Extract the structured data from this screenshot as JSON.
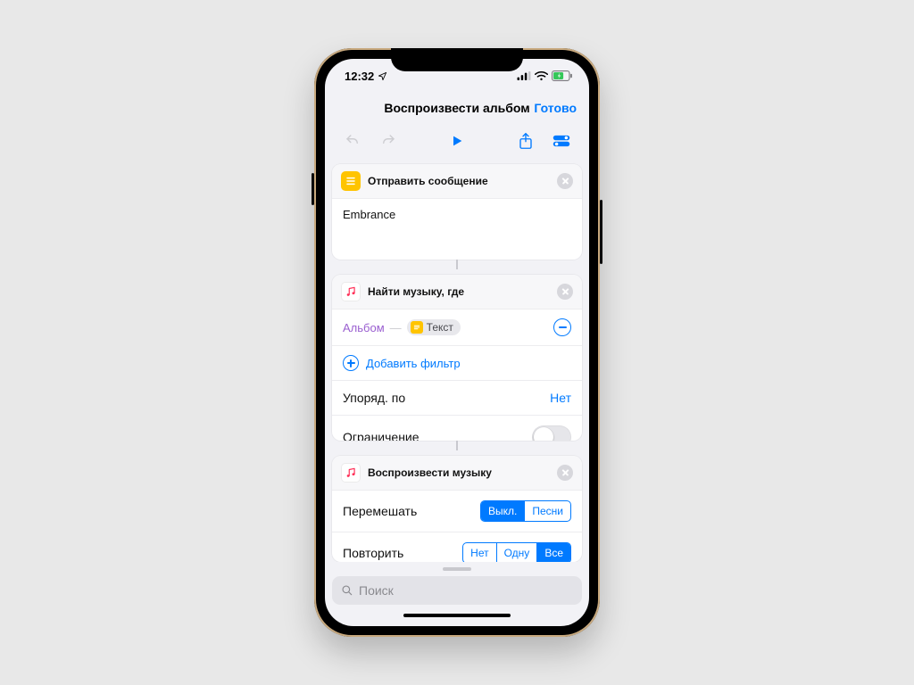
{
  "status": {
    "time": "12:32"
  },
  "nav": {
    "title": "Воспроизвести альбом",
    "done": "Готово"
  },
  "card_message": {
    "title": "Отправить сообщение",
    "text": "Embrance"
  },
  "card_find": {
    "title": "Найти музыку, где",
    "filter_field": "Альбом",
    "filter_value": "Текст",
    "add_filter": "Добавить фильтр",
    "sort_label": "Упоряд. по",
    "sort_value": "Нет",
    "limit_label": "Ограничение"
  },
  "card_play": {
    "title": "Воспроизвести музыку",
    "shuffle_label": "Перемешать",
    "shuffle_opts": [
      "Выкл.",
      "Песни"
    ],
    "shuffle_selected": 0,
    "repeat_label": "Повторить",
    "repeat_opts": [
      "Нет",
      "Одну",
      "Все"
    ],
    "repeat_selected": 2
  },
  "search_placeholder": "Поиск"
}
